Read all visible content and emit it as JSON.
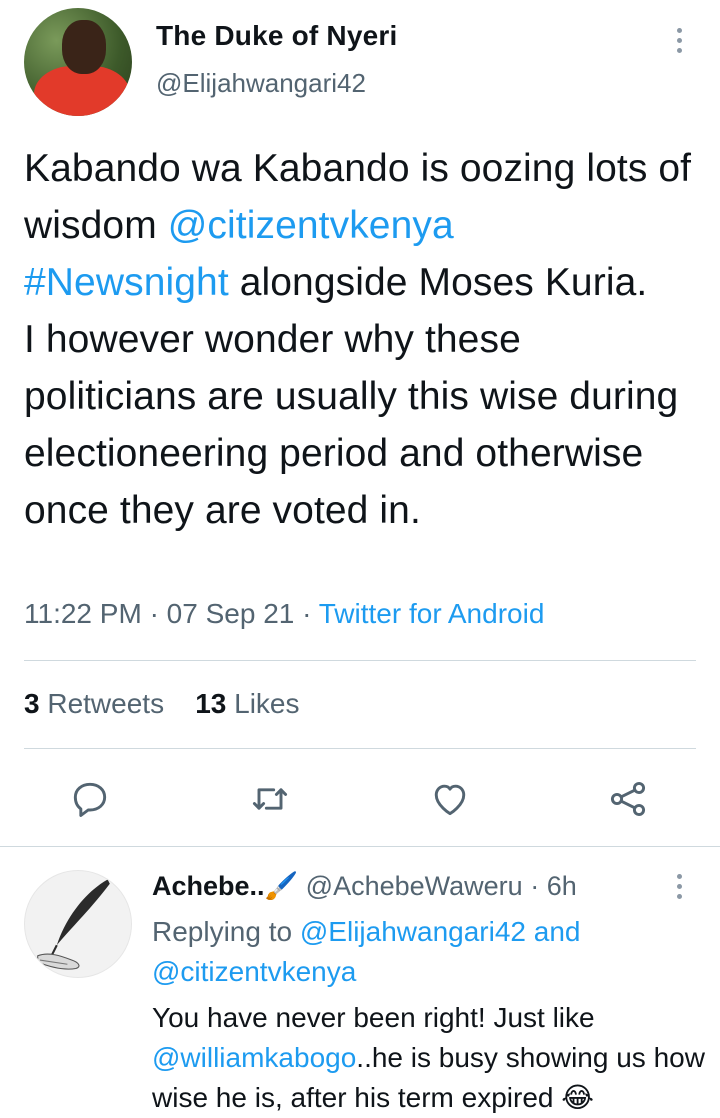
{
  "tweet": {
    "author_name": "The Duke of Nyeri",
    "author_handle": "@Elijahwangari42",
    "text_1": "Kabando wa Kabando is oozing lots of wisdom ",
    "mention_1": "@citizentvkenya",
    "hashtag_1": "#Newsnight",
    "text_2": " alongside Moses Kuria.\nI however wonder why these politicians are usually this wise during electioneering period and otherwise once they are voted in.",
    "time": "11:22 PM",
    "date": "07 Sep 21",
    "separator": "·",
    "source": "Twitter for Android",
    "retweets_count": "3",
    "retweets_label": "Retweets",
    "likes_count": "13",
    "likes_label": "Likes"
  },
  "actions": {
    "reply_icon": "reply-icon",
    "retweet_icon": "retweet-icon",
    "like_icon": "heart-icon",
    "share_icon": "share-icon"
  },
  "reply": {
    "author_name": "Achebe..🖌️",
    "author_handle": "@AchebeWaweru",
    "separator": "·",
    "age": "6h",
    "replying_prefix": "Replying to ",
    "replying_to_1": "@Elijahwangari42",
    "replying_and": " and",
    "replying_to_2": "@citizentvkenya",
    "text_1": "You have never been right! Just like ",
    "mention": "@williamkabogo",
    "text_2": "..he is busy showing us how wise he is, after his term expired 😂"
  },
  "colors": {
    "link": "#1d9bf0",
    "secondary_text": "#536471",
    "divider": "#cfd9de"
  }
}
